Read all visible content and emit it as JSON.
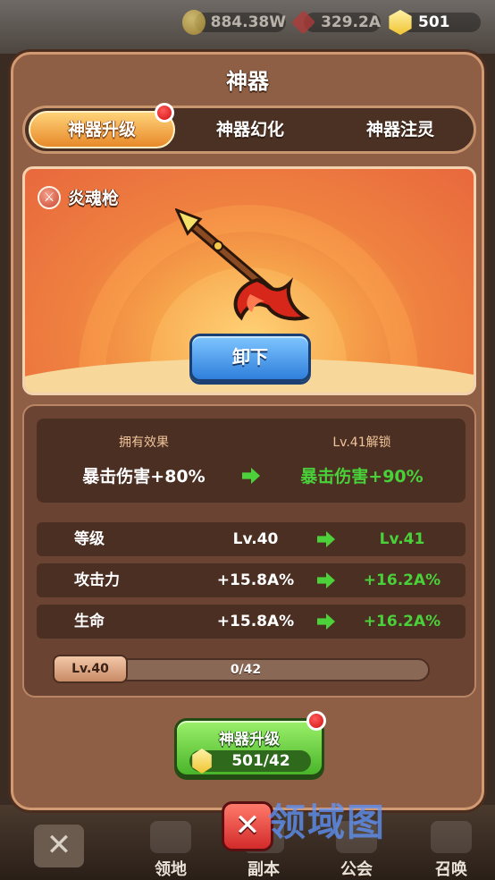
{
  "currency": {
    "gold": "884.38W",
    "gems": "329.2A",
    "tokens": "501"
  },
  "dialog": {
    "title": "神器"
  },
  "tabs": [
    {
      "label": "神器升级",
      "active": true,
      "has_notification": true
    },
    {
      "label": "神器幻化",
      "active": false
    },
    {
      "label": "神器注灵",
      "active": false
    }
  ],
  "weapon": {
    "name": "炎魂枪",
    "unequip_label": "卸下"
  },
  "effect": {
    "current_header": "拥有效果",
    "next_header": "Lv.41解锁",
    "current_value": "暴击伤害+80%",
    "next_value": "暴击伤害+90%"
  },
  "stats": [
    {
      "label": "等级",
      "current": "Lv.40",
      "next": "Lv.41"
    },
    {
      "label": "攻击力",
      "current": "+15.8A%",
      "next": "+16.2A%"
    },
    {
      "label": "生命",
      "current": "+15.8A%",
      "next": "+16.2A%"
    }
  ],
  "progress": {
    "level": "Lv.40",
    "text": "0/42",
    "fraction": 0
  },
  "upgrade": {
    "label": "神器升级",
    "cost": "501/42",
    "has_notification": true
  },
  "bottom_nav": [
    {
      "label": "领地"
    },
    {
      "label": "副本"
    },
    {
      "label": "公会"
    },
    {
      "label": "召唤"
    }
  ],
  "watermark": "领域图",
  "colors": {
    "green_value": "#49d13a",
    "active_tab": "#e7892a",
    "unequip_button": "#2f7fdc",
    "upgrade_button": "#49b52a"
  }
}
